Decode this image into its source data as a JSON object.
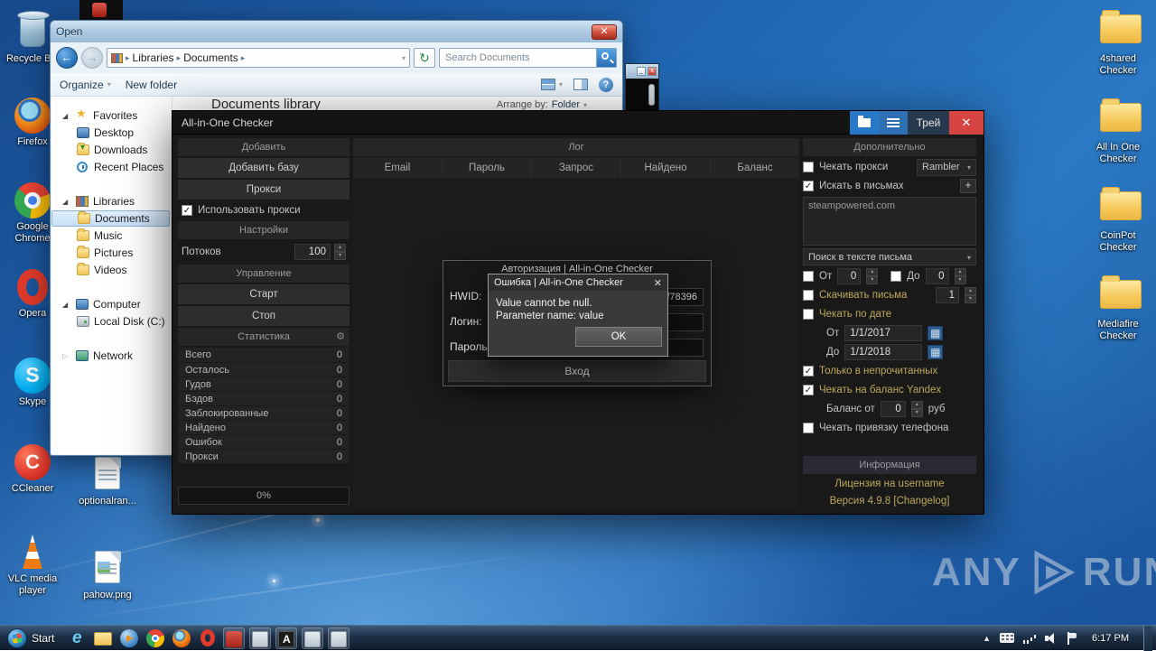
{
  "open_dialog": {
    "title": "Open",
    "breadcrumb_1": "Libraries",
    "breadcrumb_2": "Documents",
    "search_placeholder": "Search Documents",
    "organize": "Organize",
    "new_folder": "New folder",
    "tree": {
      "favorites": "Favorites",
      "desktop": "Desktop",
      "downloads": "Downloads",
      "recent": "Recent Places",
      "libraries": "Libraries",
      "documents": "Documents",
      "music": "Music",
      "pictures": "Pictures",
      "videos": "Videos",
      "computer": "Computer",
      "local_disk": "Local Disk (C:)",
      "network": "Network"
    },
    "library_title": "Documents library",
    "arrange_by": "Arrange by:",
    "arrange_value": "Folder"
  },
  "checker": {
    "title": "All-in-One Checker",
    "tray_button": "Трей",
    "left": {
      "add_header": "Добавить",
      "add_base": "Добавить базу",
      "proxy": "Прокси",
      "use_proxy": "Использовать прокси",
      "settings_header": "Настройки",
      "threads_label": "Потоков",
      "threads_value": "100",
      "control_header": "Управление",
      "start": "Старт",
      "stop": "Стоп",
      "stats_header": "Статистика",
      "stats": [
        {
          "label": "Всего",
          "value": "0"
        },
        {
          "label": "Осталось",
          "value": "0"
        },
        {
          "label": "Гудов",
          "value": "0"
        },
        {
          "label": "Бэдов",
          "value": "0"
        },
        {
          "label": "Заблокированные",
          "value": "0"
        },
        {
          "label": "Найдено",
          "value": "0"
        },
        {
          "label": "Ошибок",
          "value": "0"
        },
        {
          "label": "Прокси",
          "value": "0"
        }
      ],
      "progress": "0%"
    },
    "log": {
      "header": "Лог",
      "col_email": "Email",
      "col_password": "Пароль",
      "col_query": "Запрос",
      "col_found": "Найдено",
      "col_balance": "Баланс"
    },
    "right": {
      "header": "Дополнительно",
      "check_proxy": "Чекать прокси",
      "proxy_service": "Rambler",
      "search_letters": "Искать в письмах",
      "add_button": "+",
      "domains": "steampowered.com",
      "search_in_text": "Поиск в тексте письма",
      "from_label": "От",
      "from_value": "0",
      "to_label": "До",
      "to_value": "0",
      "download_letters": "Скачивать письма",
      "download_value": "1",
      "check_by_date": "Чекать по дате",
      "date_from_label": "От",
      "date_from": "1/1/2017",
      "date_to_label": "До",
      "date_to": "1/1/2018",
      "only_unread": "Только в непрочитанных",
      "check_balance": "Чекать на баланс Yandex",
      "balance_label": "Баланс от",
      "balance_value": "0",
      "balance_currency": "руб",
      "check_phone": "Чекать привязку телефона",
      "info_header": "Информация",
      "license": "Лицензия на username",
      "version": "Версия 4.9.8 [Changelog]"
    }
  },
  "auth_dialog": {
    "title": "Авторизация | All-in-One Checker",
    "hwid_label": "HWID:",
    "hwid_value": "5f78396",
    "login_label": "Логин:",
    "password_label": "Пароль:",
    "enter_button": "Вход"
  },
  "error_dialog": {
    "title": "Ошибка | All-in-One Checker",
    "message_1": "Value cannot be null.",
    "message_2": "Parameter name: value",
    "ok_button": "OK"
  },
  "desktop_icons": {
    "recycle_bin": "Recycle Bin",
    "firefox": "Firefox",
    "chrome": "Google Chrome",
    "opera": "Opera",
    "skype": "Skype",
    "ccleaner": "CCleaner",
    "vlc": "VLC media player",
    "optionalran": "optionalran...",
    "pahow": "pahow.png",
    "shared4": "4shared Checker",
    "allinone": "All In One Checker",
    "coinpot": "CoinPot Checker",
    "mediafire": "Mediafire Checker"
  },
  "taskbar": {
    "start": "Start",
    "time": "6:17 PM"
  },
  "watermark": {
    "any": "ANY",
    "run": "RUN"
  }
}
